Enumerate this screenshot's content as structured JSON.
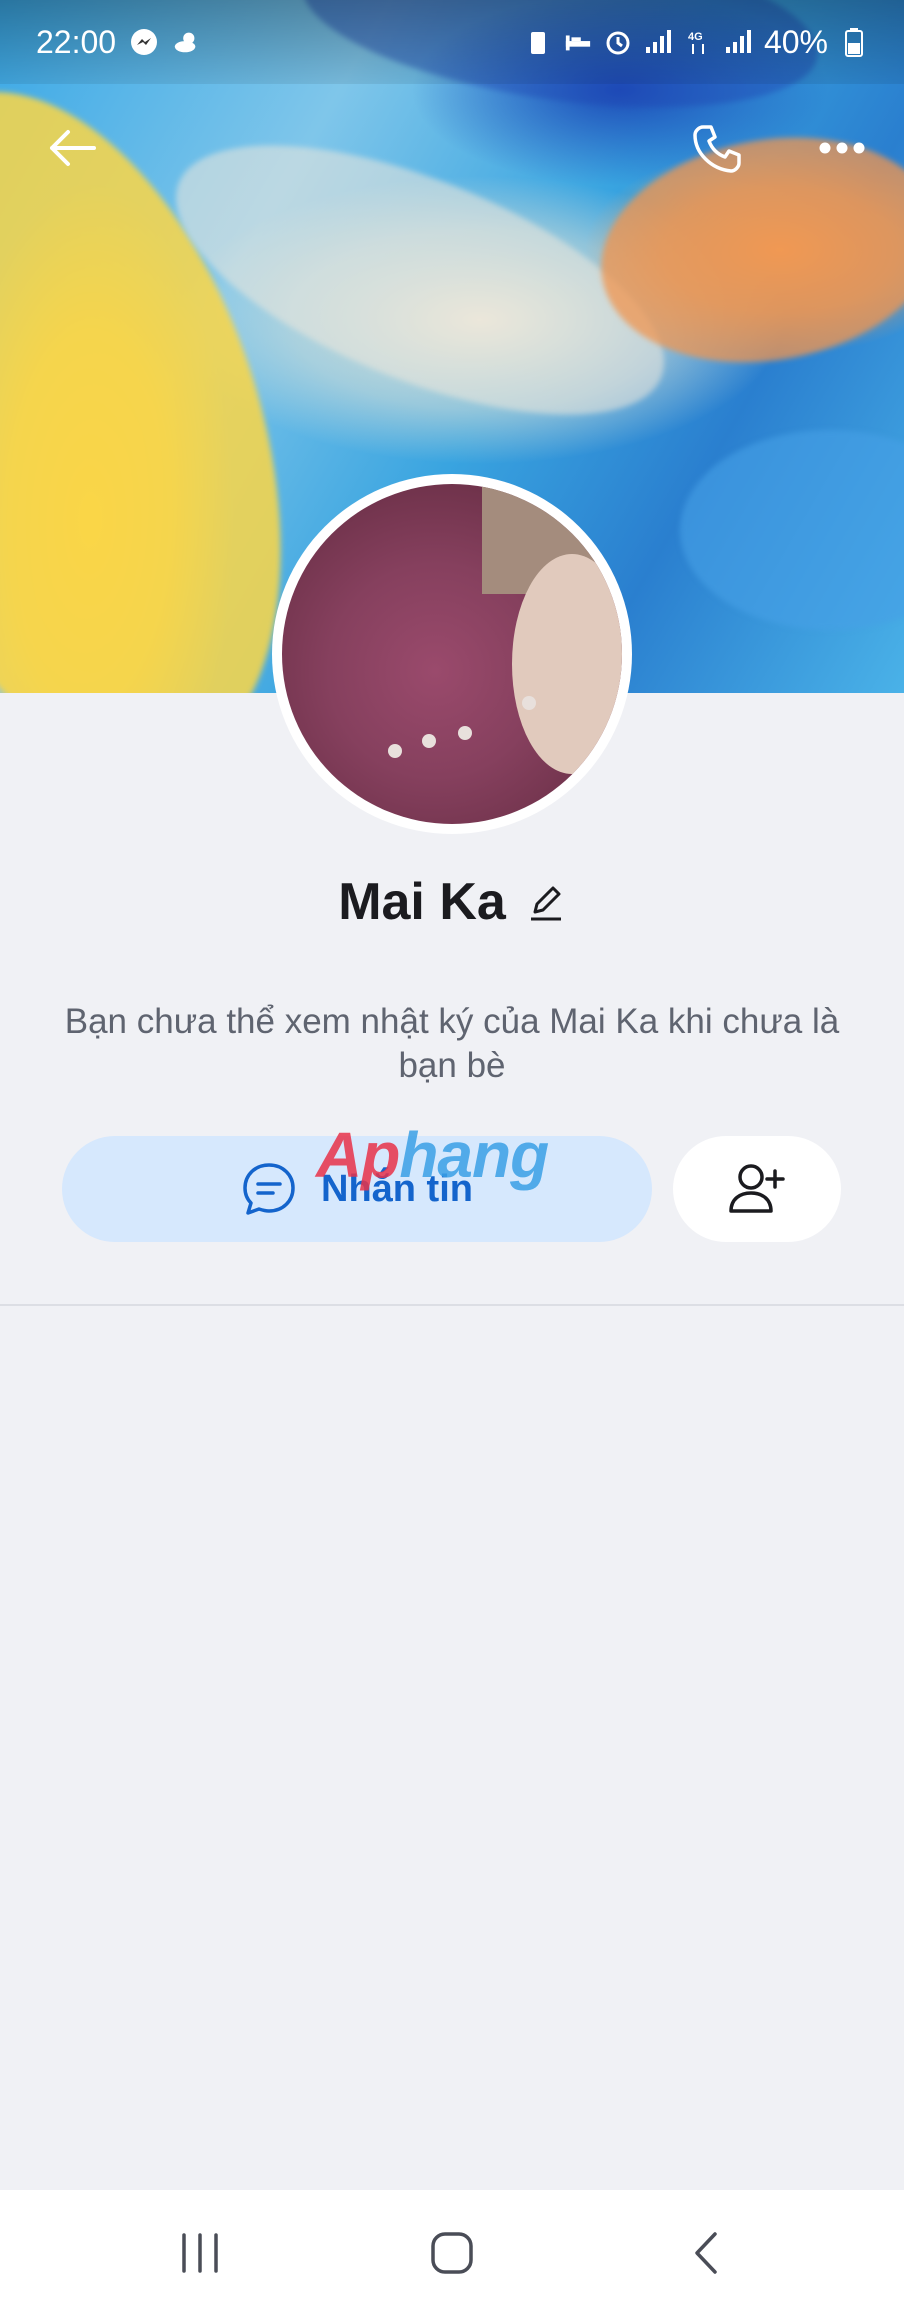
{
  "status_bar": {
    "time": "22:00",
    "battery": "40%"
  },
  "profile": {
    "name": "Mai Ka",
    "notice": "Bạn chưa thể xem nhật ký của Mai Ka khi chưa là bạn bè"
  },
  "actions": {
    "message_label": "Nhắn tin"
  },
  "watermark": {
    "part1": "Ap",
    "part2": "hang"
  },
  "icons": {
    "back": "arrow-left-icon",
    "call": "phone-icon",
    "more": "more-dots-icon",
    "edit": "pencil-icon",
    "message": "chat-bubble-icon",
    "add_friend": "add-person-icon"
  },
  "colors": {
    "accent": "#1464cc",
    "message_button_bg": "#d6e8fd",
    "page_bg": "#f0f1f5"
  }
}
